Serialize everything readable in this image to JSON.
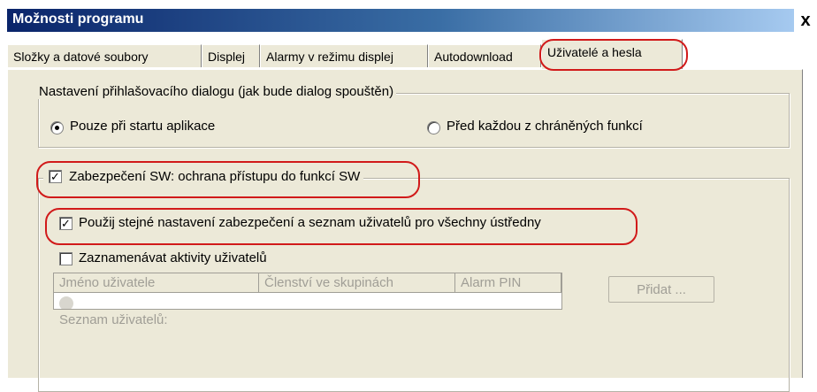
{
  "window": {
    "title": "Možnosti programu",
    "close_glyph": "x"
  },
  "tabs": [
    {
      "label": "Složky a datové soubory",
      "active": false
    },
    {
      "label": "Displej",
      "active": false
    },
    {
      "label": "Alarmy v režimu displej",
      "active": false
    },
    {
      "label": "Autodownload",
      "active": false
    },
    {
      "label": "Uživatelé a hesla",
      "active": true
    }
  ],
  "login_dialog_group": {
    "legend": "Nastavení přihlašovacího dialogu (jak bude dialog spouštěn)",
    "options": [
      {
        "label": "Pouze při startu aplikace",
        "selected": true
      },
      {
        "label": "Před každou z chráněných funkcí",
        "selected": false
      }
    ]
  },
  "security_group": {
    "legend_checkbox": {
      "label": "Zabezpečení SW: ochrana přístupu do funkcí SW",
      "checked": true
    },
    "same_settings_checkbox": {
      "label": "Použij stejné nastavení zabezpečení a seznam uživatelů pro všechny ústředny",
      "checked": true
    },
    "log_activity_checkbox": {
      "label": "Zaznamenávat aktivity uživatelů",
      "checked": false
    },
    "user_list_label": "Seznam uživatelů:",
    "columns": [
      "Jméno uživatele",
      "Členství ve skupinách",
      "Alarm PIN"
    ],
    "add_button": "Přidat ..."
  },
  "colors": {
    "annotation": "#d11a1a",
    "titlebar_start": "#0a246a",
    "dialog_bg": "#ece9d8"
  }
}
